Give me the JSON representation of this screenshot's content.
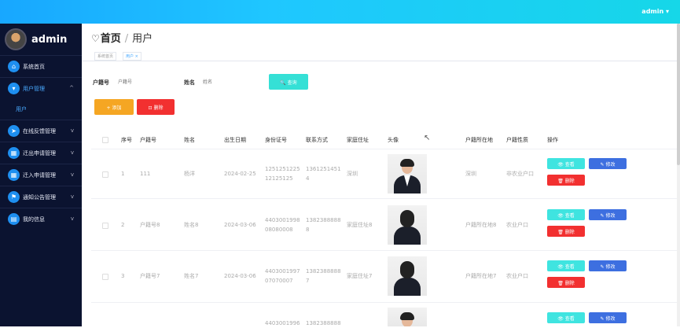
{
  "header": {
    "user_label": "admin ▾"
  },
  "sidebar": {
    "brand": "admin",
    "items": [
      {
        "label": "系统首页",
        "icon": "home-icon"
      },
      {
        "label": "用户管理",
        "icon": "user-icon",
        "active": true,
        "chevron": "^"
      },
      {
        "label": "在线反馈管理",
        "icon": "send-icon",
        "chevron": "v"
      },
      {
        "label": "迁出申请管理",
        "icon": "grid-icon",
        "chevron": "v"
      },
      {
        "label": "迁入申请管理",
        "icon": "grid-icon",
        "chevron": "v"
      },
      {
        "label": "通知公告管理",
        "icon": "flag-icon",
        "chevron": "v"
      },
      {
        "label": "我的信息",
        "icon": "card-icon",
        "chevron": "v"
      }
    ],
    "sub_item": "用户"
  },
  "page": {
    "title_home": "首页",
    "title_current": "用户",
    "breadcrumbs": [
      "系统首页",
      "用户 ×"
    ]
  },
  "search": {
    "label_hukou": "户籍号",
    "placeholder_hukou": "户籍号",
    "label_name": "姓名",
    "placeholder_name": "姓名",
    "search_btn": "🔍 查询"
  },
  "toolbar": {
    "add_btn": "+ 添加",
    "delete_btn": "⊡ 删除"
  },
  "table": {
    "columns": [
      "序号",
      "户籍号",
      "姓名",
      "出生日期",
      "身份证号",
      "联系方式",
      "家庭住址",
      "头像",
      "户籍所在地",
      "户籍性质",
      "操作"
    ],
    "rows": [
      {
        "seq": "1",
        "hukou": "111",
        "name": "杨洋",
        "birth": "2024-02-25",
        "idcard": [
          "1251251225",
          "12125125"
        ],
        "phone": [
          "1361251451",
          "4"
        ],
        "address": "深圳",
        "location": "深圳",
        "type": "非农业户口"
      },
      {
        "seq": "2",
        "hukou": "户籍号8",
        "name": "姓名8",
        "birth": "2024-03-06",
        "idcard": [
          "4403001998",
          "08080008"
        ],
        "phone": [
          "1382388888",
          "8"
        ],
        "address": "家庭住址8",
        "location": "户籍所在地8",
        "type": "农业户口"
      },
      {
        "seq": "3",
        "hukou": "户籍号7",
        "name": "姓名7",
        "birth": "2024-03-06",
        "idcard": [
          "4403001997",
          "07070007"
        ],
        "phone": [
          "1382388888",
          "7"
        ],
        "address": "家庭住址7",
        "location": "户籍所在地7",
        "type": "农业户口"
      },
      {
        "seq": "",
        "hukou": "",
        "name": "",
        "birth": "",
        "idcard": [
          "4403001996",
          ""
        ],
        "phone": [
          "1382388888",
          ""
        ],
        "address": "",
        "location": "",
        "type": ""
      }
    ],
    "actions": {
      "view": "👁 查看",
      "edit": "✎ 修改",
      "delete": "🗑 删除"
    }
  }
}
